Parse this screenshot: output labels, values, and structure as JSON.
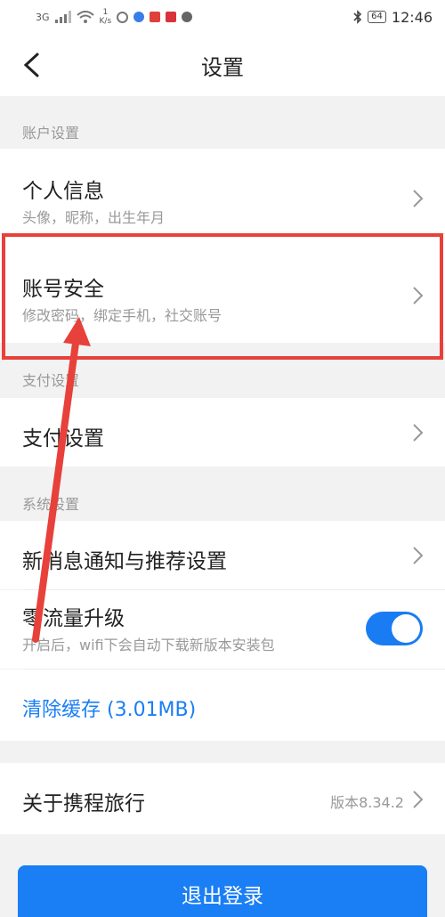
{
  "status_bar": {
    "net_type": "3G",
    "speed_value": "1",
    "speed_unit": "K/s",
    "battery": "64",
    "time": "12:46"
  },
  "header": {
    "title": "设置"
  },
  "sections": {
    "account": "账户设置",
    "payment": "支付设置",
    "system": "系统设置"
  },
  "rows": {
    "personal_info": {
      "title": "个人信息",
      "subtitle": "头像，昵称，出生年月"
    },
    "account_security": {
      "title": "账号安全",
      "subtitle": "修改密码，绑定手机，社交账号"
    },
    "payment_settings": {
      "title": "支付设置"
    },
    "notifications": {
      "title": "新消息通知与推荐设置"
    },
    "zero_traffic": {
      "title": "零流量升级",
      "subtitle": "开启后，wifi下会自动下载新版本安装包",
      "enabled": true
    },
    "clear_cache": {
      "title": "清除缓存 (3.01MB)"
    },
    "about": {
      "title": "关于携程旅行",
      "version": "版本8.34.2"
    }
  },
  "logout": {
    "label": "退出登录"
  },
  "colors": {
    "accent": "#1a7ef5",
    "highlight": "#e8403a"
  }
}
